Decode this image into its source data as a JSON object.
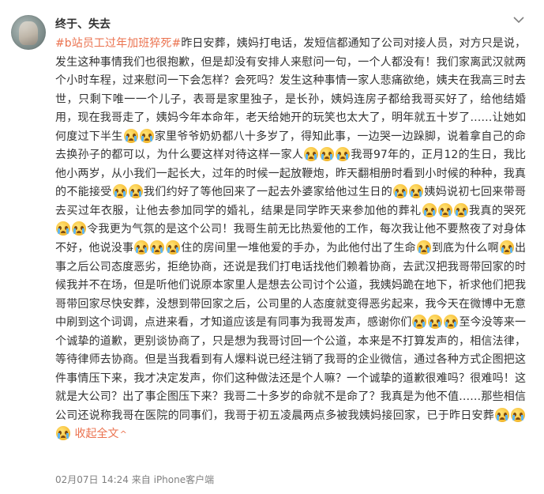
{
  "post": {
    "username": "终于、失去",
    "more_icon": "chevron-down-icon",
    "hashtag": "#b站员工过年加班猝死#",
    "segments": [
      "昨日安葬，姨妈打电话，发短信都通知了公司对接人员，对方只是说，发生这种事情我们也很抱歉，但是却没有安排人来慰问一句，一个人都没有！我们家离武汉就两个小时车程，过来慰问一下会怎样？会死吗？发生这种事情一家人悲痛欲绝，姨夫在我高三时去世，只剩下唯一一个儿子，表哥是家里独子，是长孙，姨妈连房子都给我哥买好了，给他结婚用，现在我哥走了，姨妈今年本命年，老天给她开的玩笑也太大了，明年就五十岁了……让她如何度过下半生",
      "家里爷爷奶奶都八十多岁了，得知此事，一边哭一边跺脚，说着拿自己的命去换孙子的都可以，为什么要这样对待这样一家人",
      "我哥97年的，正月12的生日，我比他小两岁，从小我们一起长大，过年的时候一起放鞭炮，昨天翻相册时看到小时候的种种，我真的不能接受",
      "我们约好了等他回来了一起去外婆家给他过生日的",
      "姨妈说初七回来带哥去买过年衣服，让他去参加同学的婚礼，结果是同学昨天来参加他的葬礼",
      "我真的哭死",
      "令我更为气氛的是这个公司！我哥生前无比热爱他的工作，每次我让他不要熬夜了对身体不好，他说没事",
      "住的房间里一堆他爱的手办，为此他付出了生命",
      "到底为什么啊",
      "出事之后公司态度恶劣，拒绝协商，还说是我们打电话找他们赖着协商，去武汉把我哥带回家的时候我并不在场，但是听他们说原本家里人是想去公司讨个公道，我姨妈跪在地下，祈求他们把我哥带回家尽快安葬，没想到带回家之后，公司里的人态度就变得恶劣起来，我今天在微博中无意中刷到这个词调，点进来看，才知道应该是有同事为我哥发声，感谢你们",
      "至今没等来一个诚挚的道歉，更别谈协商了，只是想为我哥讨回一个公道，本来是不打算发声的，相信法律，等待律师去协商。但是当我看到有人爆料说已经注销了我哥的企业微信，通过各种方式企图把这件事情压下来，我才决定发声，你们这种做法还是个人嘛？一个诚挚的道歉很难吗？很难吗！这就是大公司？出了事企图压下来？我哥二十多岁的命就不是命了？我真是为他不值……那些相信公司还说称我哥在医院的同事们，我哥于初五凌晨两点多被我姨妈接回家，已于昨日安葬"
    ],
    "emoji_name": "crying-face-icon",
    "collapse_label": "收起全文",
    "collapse_arrow": "^",
    "time": "02月07日 14:24",
    "source_prefix": "来自",
    "source": "iPhone客户端"
  }
}
